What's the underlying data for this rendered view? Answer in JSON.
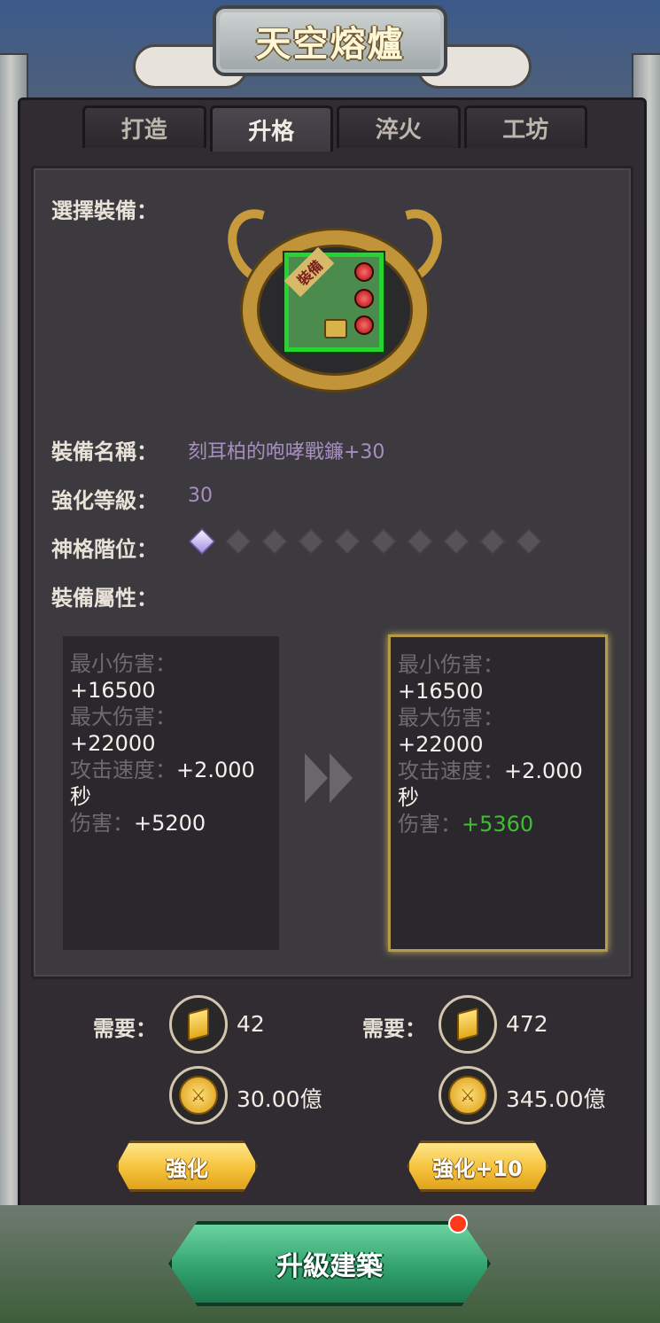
{
  "title": "天空熔爐",
  "tabs": [
    {
      "label": "打造",
      "active": false
    },
    {
      "label": "升格",
      "active": true
    },
    {
      "label": "淬火",
      "active": false
    },
    {
      "label": "工坊",
      "active": false
    }
  ],
  "select_label": "選擇裝備：",
  "equipment": {
    "ribbon": "裝備",
    "name_label": "裝備名稱：",
    "name": "刻耳柏的咆哮戰鐮+30",
    "level_label": "強化等級：",
    "level": "30",
    "rank_label": "神格階位：",
    "rank_current": 1,
    "rank_max": 10,
    "attr_label": "裝備屬性："
  },
  "stats_current": {
    "min_label": "最小伤害：",
    "min_value": "+16500",
    "max_label": "最大伤害：",
    "max_value": "+22000",
    "speed_label": "攻击速度：",
    "speed_value": "+2.000",
    "speed_unit": "秒",
    "dmg_label": "伤害：",
    "dmg_value": "+5200"
  },
  "stats_next": {
    "min_label": "最小伤害：",
    "min_value": "+16500",
    "max_label": "最大伤害：",
    "max_value": "+22000",
    "speed_label": "攻击速度：",
    "speed_value": "+2.000",
    "speed_unit": "秒",
    "dmg_label": "伤害：",
    "dmg_value": "+5360"
  },
  "cost_single": {
    "need_label": "需要：",
    "crystal": "42",
    "gold": "30.00億",
    "button": "強化"
  },
  "cost_ten": {
    "need_label": "需要：",
    "crystal": "472",
    "gold": "345.00億",
    "button": "強化+10"
  },
  "upgrade_button": "升級建築",
  "colors": {
    "accent_gold": "#f5c23a",
    "stat_up": "#3fbf2f",
    "name_purple": "#a78fbf",
    "upgrade_green": "#2f9e6a"
  }
}
